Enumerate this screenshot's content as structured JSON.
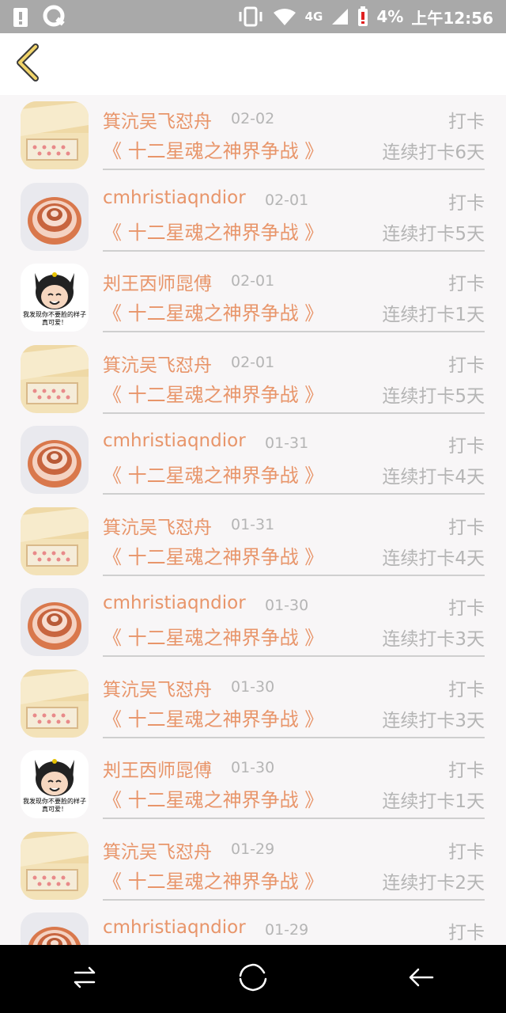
{
  "status_bar": {
    "network": "4G",
    "battery": "4%",
    "time": "上午12:56"
  },
  "header": {
    "back_icon": "chevron-left-icon"
  },
  "records": [
    {
      "user": "箕沆吴飞怼舟",
      "avatar": "cake-avatar",
      "date": "02-02",
      "action": "打卡",
      "book": "《 十二星魂之神界争战 》",
      "streak": "连续打卡6天"
    },
    {
      "user": "cmhristiaqndior",
      "avatar": "shell-avatar",
      "date": "02-01",
      "action": "打卡",
      "book": "《 十二星魂之神界争战 》",
      "streak": "连续打卡5天"
    },
    {
      "user": "刔王㐁师㖯傅",
      "avatar": "cat-avatar",
      "date": "02-01",
      "action": "打卡",
      "book": "《 十二星魂之神界争战 》",
      "streak": "连续打卡1天",
      "avatar_caption": "我发现你不要脸的样子真可爱！"
    },
    {
      "user": "箕沆吴飞怼舟",
      "avatar": "cake-avatar",
      "date": "02-01",
      "action": "打卡",
      "book": "《 十二星魂之神界争战 》",
      "streak": "连续打卡5天"
    },
    {
      "user": "cmhristiaqndior",
      "avatar": "shell-avatar",
      "date": "01-31",
      "action": "打卡",
      "book": "《 十二星魂之神界争战 》",
      "streak": "连续打卡4天"
    },
    {
      "user": "箕沆吴飞怼舟",
      "avatar": "cake-avatar",
      "date": "01-31",
      "action": "打卡",
      "book": "《 十二星魂之神界争战 》",
      "streak": "连续打卡4天"
    },
    {
      "user": "cmhristiaqndior",
      "avatar": "shell-avatar",
      "date": "01-30",
      "action": "打卡",
      "book": "《 十二星魂之神界争战 》",
      "streak": "连续打卡3天"
    },
    {
      "user": "箕沆吴飞怼舟",
      "avatar": "cake-avatar",
      "date": "01-30",
      "action": "打卡",
      "book": "《 十二星魂之神界争战 》",
      "streak": "连续打卡3天"
    },
    {
      "user": "刔王㐁师㖯傅",
      "avatar": "cat-avatar",
      "date": "01-30",
      "action": "打卡",
      "book": "《 十二星魂之神界争战 》",
      "streak": "连续打卡1天",
      "avatar_caption": "我发现你不要脸的样子真可爱！"
    },
    {
      "user": "箕沆吴飞怼舟",
      "avatar": "cake-avatar",
      "date": "01-29",
      "action": "打卡",
      "book": "《 十二星魂之神界争战 》",
      "streak": "连续打卡2天"
    },
    {
      "user": "cmhristiaqndior",
      "avatar": "shell-avatar",
      "date": "01-29",
      "action": "打卡",
      "book": "",
      "streak": ""
    }
  ],
  "nav_bar": {
    "items": [
      "switch-apps-icon",
      "home-icon",
      "back-icon"
    ]
  }
}
